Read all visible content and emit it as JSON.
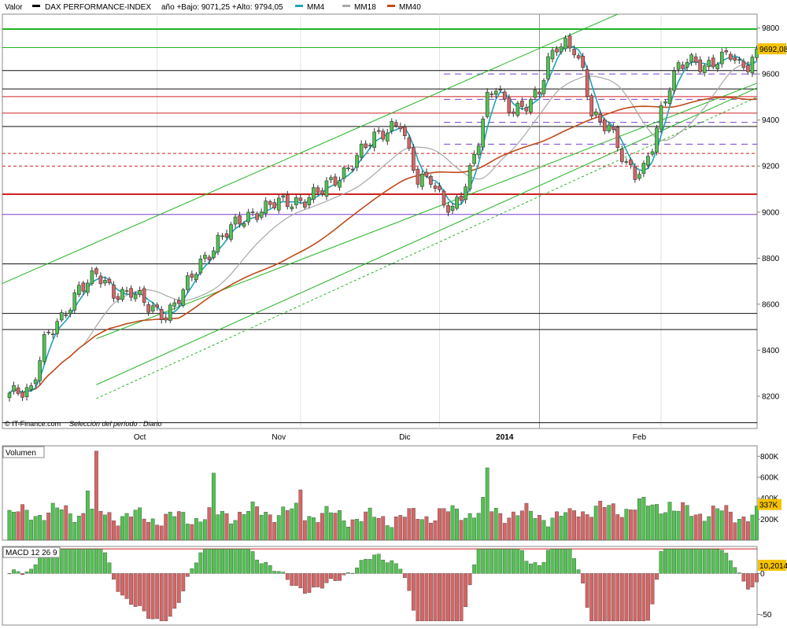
{
  "header": {
    "valor_label": "Valor",
    "index_name": "DAX PERFORMANCE-INDEX",
    "range_text": "año +Bajo: 9071,25 +Alto: 9794,05",
    "mm4": "MM4",
    "mm18": "MM18",
    "mm40": "MM40"
  },
  "footer": {
    "source": "© IT-Finance.com",
    "period": "Selección del período : Diario"
  },
  "colors": {
    "bull": "#4fc44f",
    "bear": "#d96464",
    "mm4": "#1fa3b8",
    "mm18": "#a8a8a8",
    "mm40": "#c04a18",
    "trend": "#22b422",
    "purple": "#7b3fd0",
    "red_level": "#d02020",
    "last_price_bg": "#f5c200"
  },
  "chart_data": [
    {
      "type": "candlestick",
      "title": "DAX PERFORMANCE-INDEX",
      "ylim": [
        8060,
        9860
      ],
      "yticks": [
        8200,
        8400,
        8600,
        8800,
        9000,
        9200,
        9400,
        9600,
        9800
      ],
      "month_labels": [
        "Oct",
        "Nov",
        "Dic",
        "2014",
        "Feb"
      ],
      "last_price": "9692,08",
      "legend": [
        "MM4",
        "MM18",
        "MM40"
      ],
      "levels": {
        "black": [
          9615,
          9535,
          9372,
          9078,
          8775,
          8560,
          8490,
          8085
        ],
        "green": [
          9795,
          9715
        ],
        "red": [
          9502,
          9430
        ],
        "red_dashed": [
          9255,
          9200
        ],
        "purple": [
          8990
        ],
        "purple_dashed": [
          9600,
          9490,
          9390,
          9295
        ]
      }
    },
    {
      "type": "bar",
      "title": "Volumen",
      "ylim": [
        0,
        900
      ],
      "yticks": [
        "200K",
        "400K",
        "600K",
        "800K"
      ],
      "last_value": "337K"
    },
    {
      "type": "bar",
      "title": "MACD 12 26 9",
      "ylim": [
        -63,
        33
      ],
      "yticks": [
        "0",
        "-50"
      ],
      "last_value": "10,2014"
    }
  ]
}
